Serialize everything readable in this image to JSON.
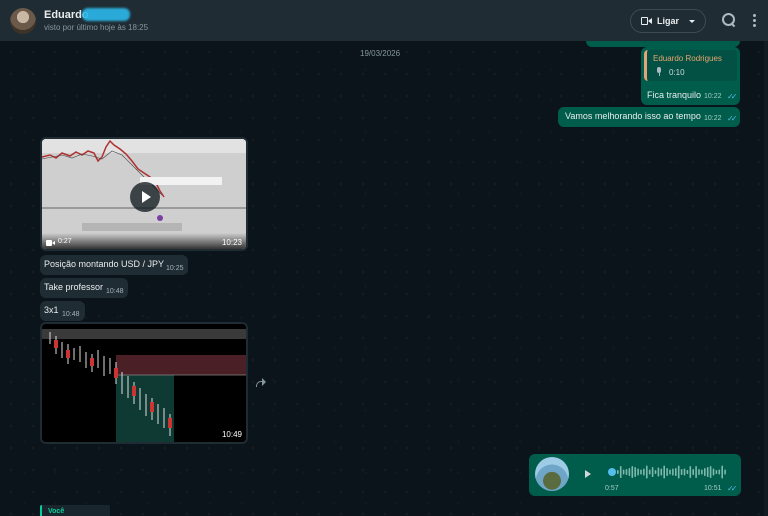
{
  "header": {
    "name": "Eduardo",
    "status": "visto por último hoje às 18:25",
    "call_label": "Ligar"
  },
  "chat": {
    "date": "19/03/2026",
    "outgoing_reply": {
      "quoted_author": "Eduardo Rodrigues",
      "quoted_duration": "0:10",
      "text": "Fica tranquilo",
      "time": "10:22"
    },
    "outgoing_msg": {
      "text": "Vamos melhorando isso ao tempo",
      "time": "10:22"
    },
    "video": {
      "duration": "0:27",
      "time": "10:23"
    },
    "incoming": [
      {
        "text": "Posição montando USD / JPY",
        "time": "10:25"
      },
      {
        "text": "Take professor",
        "time": "10:48"
      },
      {
        "text": "3x1",
        "time": "10:48"
      }
    ],
    "image": {
      "time": "10:49"
    },
    "audio": {
      "duration": "0:57",
      "time": "10:51",
      "progress": 0
    },
    "bottom_label": "Você"
  },
  "colors": {
    "outgoing_bubble": "#005c4b",
    "incoming_bubble": "#202c33",
    "header": "#202c33",
    "read_ticks": "#53bdeb",
    "quote_author": "#e9a56e"
  }
}
